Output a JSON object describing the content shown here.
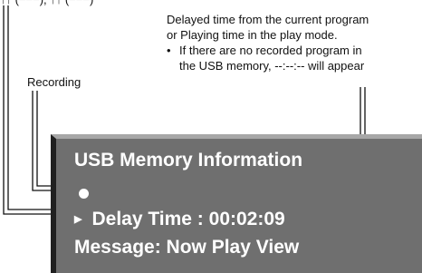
{
  "top_fragment": "↑↑ (−−−), ↑↑ (−−−)",
  "callouts": {
    "recording": "Recording",
    "delay_line1": "Delayed time from the current program",
    "delay_line2": "or Playing time in the play mode.",
    "delay_bullet": "•",
    "delay_line3": "If there are no recorded program in",
    "delay_line4": "the USB memory, --:--:-- will appear"
  },
  "panel": {
    "title": "USB Memory Information",
    "recording_indicator": "●",
    "play_icon": "play-arrow-icon",
    "play_arrow": "▶",
    "delay_label": "Delay Time : 00:02:09",
    "message": "Message: Now Play View"
  },
  "colors": {
    "panel_bg": "#6f6f6f",
    "panel_top_border": "#a7a7a7",
    "panel_left_border": "#202020",
    "panel_text": "#ffffff",
    "lines": "#111111"
  }
}
